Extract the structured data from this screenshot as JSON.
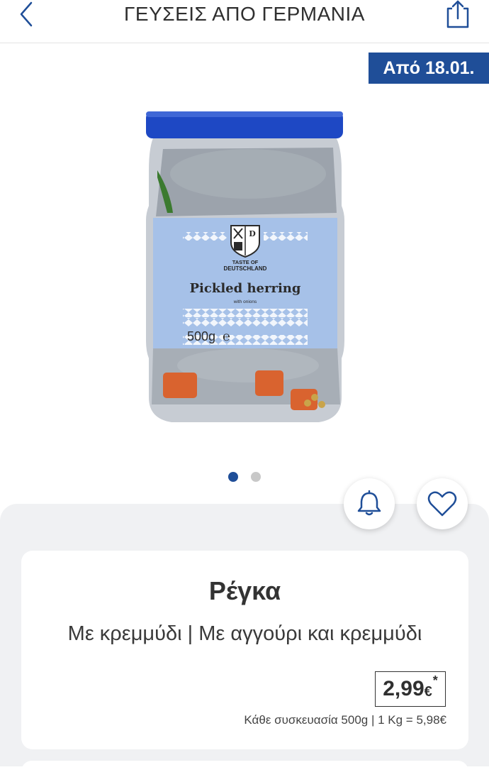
{
  "header": {
    "title": "ΓΕΥΣΕΙΣ ΑΠΟ ΓΕΡΜΑΝΙΑ",
    "back_icon": "chevron-left-icon",
    "share_icon": "share-icon"
  },
  "badge": {
    "text": "Από 18.01."
  },
  "product_image": {
    "brand_line1": "TASTE OF",
    "brand_line2": "DEUTSCHLAND",
    "label_title": "Pickled herring",
    "label_subtitle": "with onions",
    "weight": "500g",
    "logo_letter": "D"
  },
  "carousel": {
    "count": 2,
    "active_index": 0
  },
  "actions": {
    "bell_icon": "bell-icon",
    "heart_icon": "heart-icon"
  },
  "product": {
    "name": "Ρέγκα",
    "variants": "Με κρεμμύδι | Με αγγούρι και κρεμμύδι",
    "price": "2,99",
    "currency": "€",
    "price_marker": "*",
    "unit_info": "Κάθε συσκευασία 500g | 1 Kg = 5,98€"
  },
  "colors": {
    "brand_blue": "#1f4e98",
    "lid_blue": "#1e48c4",
    "label_blue": "#a6c1e8",
    "panel_bg": "#f0f1f3"
  }
}
